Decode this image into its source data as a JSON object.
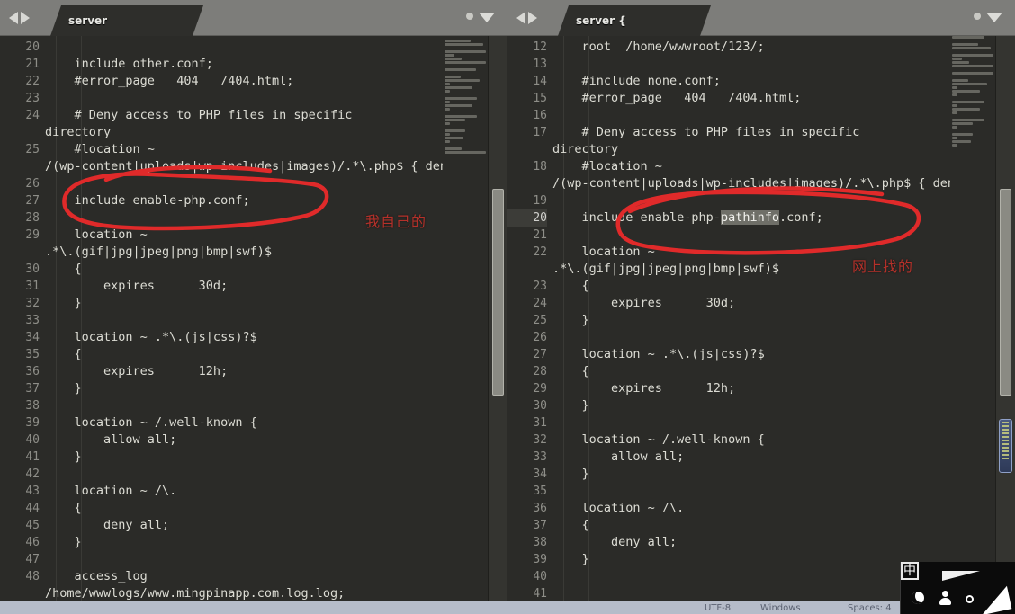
{
  "app": {
    "status_bar": {
      "encoding": "UTF-8",
      "line_ending": "Windows",
      "indentation": "Spaces: 4"
    },
    "ime": {
      "mode_label": "中"
    }
  },
  "panes": [
    {
      "id": "left",
      "tab": {
        "label": "server",
        "modified_dot": true
      },
      "annotation": {
        "text": "我自己的",
        "color": "#b5312a"
      },
      "lines": [
        {
          "num": "20",
          "text": "",
          "wrapped": false,
          "active": false
        },
        {
          "num": "21",
          "text": "    include other.conf;",
          "wrapped": false,
          "active": false
        },
        {
          "num": "22",
          "text": "    #error_page   404   /404.html;",
          "wrapped": false,
          "active": false
        },
        {
          "num": "23",
          "text": "",
          "wrapped": false,
          "active": false
        },
        {
          "num": "24",
          "text": "    # Deny access to PHP files in specific directory",
          "wrapped": true,
          "active": false
        },
        {
          "num": "25",
          "text": "    #location ~ /(wp-content|uploads|wp-includes|images)/.*\\.php$ { deny all; }",
          "wrapped": true,
          "active": false
        },
        {
          "num": "26",
          "text": "",
          "wrapped": false,
          "active": false
        },
        {
          "num": "27",
          "text": "    include enable-php.conf;",
          "wrapped": false,
          "active": false
        },
        {
          "num": "28",
          "text": "",
          "wrapped": false,
          "active": false
        },
        {
          "num": "29",
          "text": "    location ~ .*\\.(gif|jpg|jpeg|png|bmp|swf)$",
          "wrapped": true,
          "active": false
        },
        {
          "num": "30",
          "text": "    {",
          "wrapped": false,
          "active": false
        },
        {
          "num": "31",
          "text": "        expires      30d;",
          "wrapped": false,
          "active": false
        },
        {
          "num": "32",
          "text": "    }",
          "wrapped": false,
          "active": false
        },
        {
          "num": "33",
          "text": "",
          "wrapped": false,
          "active": false
        },
        {
          "num": "34",
          "text": "    location ~ .*\\.(js|css)?$",
          "wrapped": false,
          "active": false
        },
        {
          "num": "35",
          "text": "    {",
          "wrapped": false,
          "active": false
        },
        {
          "num": "36",
          "text": "        expires      12h;",
          "wrapped": false,
          "active": false
        },
        {
          "num": "37",
          "text": "    }",
          "wrapped": false,
          "active": false
        },
        {
          "num": "38",
          "text": "",
          "wrapped": false,
          "active": false
        },
        {
          "num": "39",
          "text": "    location ~ /.well-known {",
          "wrapped": false,
          "active": false
        },
        {
          "num": "40",
          "text": "        allow all;",
          "wrapped": false,
          "active": false
        },
        {
          "num": "41",
          "text": "    }",
          "wrapped": false,
          "active": false
        },
        {
          "num": "42",
          "text": "",
          "wrapped": false,
          "active": false
        },
        {
          "num": "43",
          "text": "    location ~ /\\.",
          "wrapped": false,
          "active": false
        },
        {
          "num": "44",
          "text": "    {",
          "wrapped": false,
          "active": false
        },
        {
          "num": "45",
          "text": "        deny all;",
          "wrapped": false,
          "active": false
        },
        {
          "num": "46",
          "text": "    }",
          "wrapped": false,
          "active": false
        },
        {
          "num": "47",
          "text": "",
          "wrapped": false,
          "active": false
        },
        {
          "num": "48",
          "text": "    access_log  /home/wwwlogs/www.mingpinapp.com.log.log;",
          "wrapped": true,
          "active": false
        }
      ]
    },
    {
      "id": "right",
      "tab": {
        "label": "server {",
        "modified_dot": true
      },
      "annotation": {
        "text": "网上找的",
        "color": "#b5312a"
      },
      "selection_text": "pathinfo",
      "lines": [
        {
          "num": "12",
          "text": "    root  /home/wwwroot/123/;",
          "wrapped": false,
          "active": false
        },
        {
          "num": "13",
          "text": "",
          "wrapped": false,
          "active": false
        },
        {
          "num": "14",
          "text": "    #include none.conf;",
          "wrapped": false,
          "active": false
        },
        {
          "num": "15",
          "text": "    #error_page   404   /404.html;",
          "wrapped": false,
          "active": false
        },
        {
          "num": "16",
          "text": "",
          "wrapped": false,
          "active": false
        },
        {
          "num": "17",
          "text": "    # Deny access to PHP files in specific directory",
          "wrapped": true,
          "active": false
        },
        {
          "num": "18",
          "text": "    #location ~ /(wp-content|uploads|wp-includes|images)/.*\\.php$ { deny all; }",
          "wrapped": true,
          "active": false
        },
        {
          "num": "19",
          "text": "",
          "wrapped": false,
          "active": false
        },
        {
          "num": "20",
          "text": "    include enable-php-pathinfo.conf;",
          "wrapped": false,
          "active": true
        },
        {
          "num": "21",
          "text": "",
          "wrapped": false,
          "active": false
        },
        {
          "num": "22",
          "text": "    location ~ .*\\.(gif|jpg|jpeg|png|bmp|swf)$",
          "wrapped": true,
          "active": false
        },
        {
          "num": "23",
          "text": "    {",
          "wrapped": false,
          "active": false
        },
        {
          "num": "24",
          "text": "        expires      30d;",
          "wrapped": false,
          "active": false
        },
        {
          "num": "25",
          "text": "    }",
          "wrapped": false,
          "active": false
        },
        {
          "num": "26",
          "text": "",
          "wrapped": false,
          "active": false
        },
        {
          "num": "27",
          "text": "    location ~ .*\\.(js|css)?$",
          "wrapped": false,
          "active": false
        },
        {
          "num": "28",
          "text": "    {",
          "wrapped": false,
          "active": false
        },
        {
          "num": "29",
          "text": "        expires      12h;",
          "wrapped": false,
          "active": false
        },
        {
          "num": "30",
          "text": "    }",
          "wrapped": false,
          "active": false
        },
        {
          "num": "31",
          "text": "",
          "wrapped": false,
          "active": false
        },
        {
          "num": "32",
          "text": "    location ~ /.well-known {",
          "wrapped": false,
          "active": false
        },
        {
          "num": "33",
          "text": "        allow all;",
          "wrapped": false,
          "active": false
        },
        {
          "num": "34",
          "text": "    }",
          "wrapped": false,
          "active": false
        },
        {
          "num": "35",
          "text": "",
          "wrapped": false,
          "active": false
        },
        {
          "num": "36",
          "text": "    location ~ /\\.",
          "wrapped": false,
          "active": false
        },
        {
          "num": "37",
          "text": "    {",
          "wrapped": false,
          "active": false
        },
        {
          "num": "38",
          "text": "        deny all;",
          "wrapped": false,
          "active": false
        },
        {
          "num": "39",
          "text": "    }",
          "wrapped": false,
          "active": false
        },
        {
          "num": "40",
          "text": "",
          "wrapped": false,
          "active": false
        },
        {
          "num": "41",
          "text": "",
          "wrapped": false,
          "active": false
        }
      ]
    }
  ]
}
